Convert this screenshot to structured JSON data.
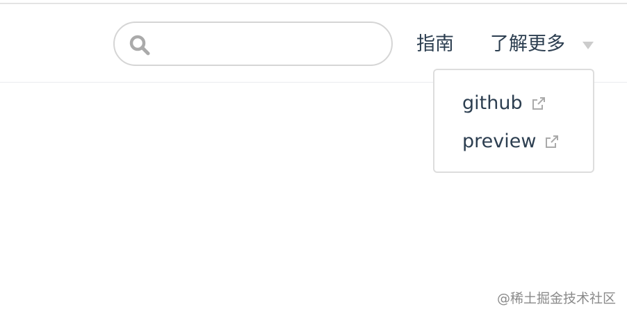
{
  "search": {
    "value": "",
    "placeholder": ""
  },
  "nav": {
    "items": [
      {
        "label": "指南"
      },
      {
        "label": "了解更多"
      }
    ]
  },
  "dropdown": {
    "items": [
      {
        "label": "github",
        "icon": "external-link-icon"
      },
      {
        "label": "preview",
        "icon": "external-link-icon"
      }
    ]
  },
  "watermark": "@稀土掘金技术社区",
  "colors": {
    "text": "#2c3e50",
    "border": "#d5d5d5",
    "icon_gray": "#aaaaaa",
    "caret": "#cccccc"
  }
}
